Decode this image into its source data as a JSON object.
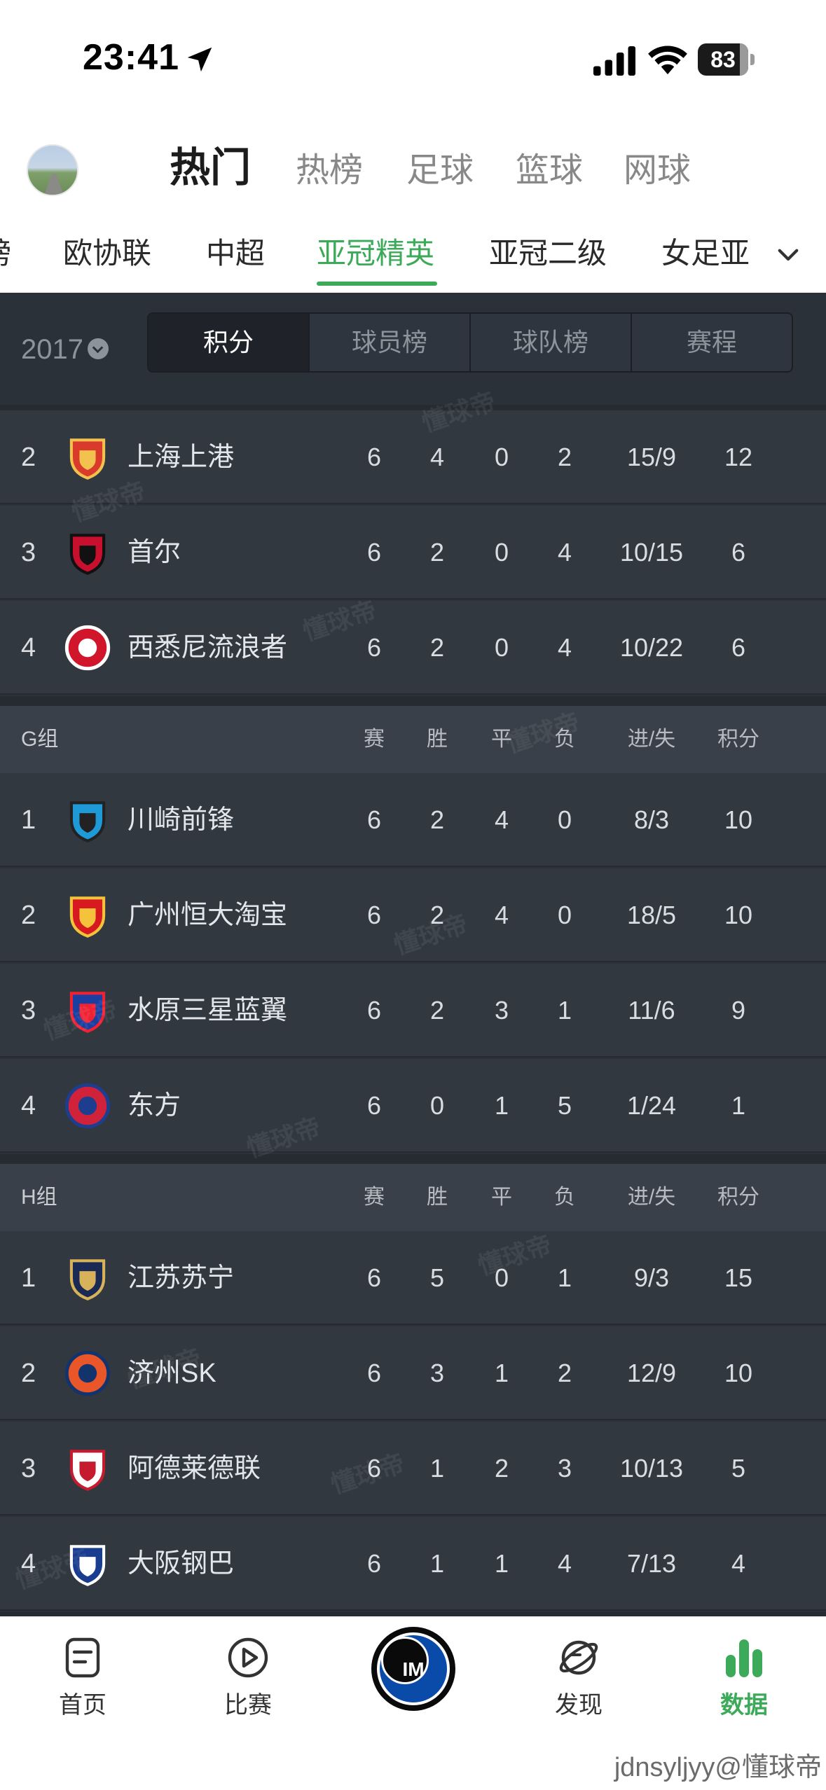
{
  "status_bar": {
    "time": "23:41",
    "battery": "83",
    "battery_level": 0.83
  },
  "header": {
    "main_tabs": [
      {
        "label": "热门",
        "active": true
      },
      {
        "label": "热榜"
      },
      {
        "label": "足球"
      },
      {
        "label": "篮球"
      },
      {
        "label": "网球"
      }
    ],
    "sub_tabs": [
      {
        "label": "榜"
      },
      {
        "label": "欧协联"
      },
      {
        "label": "中超"
      },
      {
        "label": "亚冠精英",
        "active": true
      },
      {
        "label": "亚冠二级"
      },
      {
        "label": "女足亚"
      }
    ]
  },
  "controls": {
    "year": "2017",
    "segments": [
      {
        "label": "积分",
        "active": true
      },
      {
        "label": "球员榜"
      },
      {
        "label": "球队榜"
      },
      {
        "label": "赛程"
      }
    ]
  },
  "columns": [
    "赛",
    "胜",
    "平",
    "负",
    "进/失",
    "积分"
  ],
  "partial_group": {
    "rows": [
      {
        "rank": "2",
        "team": "上海上港",
        "logo": "shanghai-sipg-crest",
        "p": "6",
        "w": "4",
        "d": "0",
        "l": "2",
        "gd": "15/9",
        "pts": "12"
      },
      {
        "rank": "3",
        "team": "首尔",
        "logo": "fc-seoul-crest",
        "p": "6",
        "w": "2",
        "d": "0",
        "l": "4",
        "gd": "10/15",
        "pts": "6"
      },
      {
        "rank": "4",
        "team": "西悉尼流浪者",
        "logo": "western-sydney-crest",
        "p": "6",
        "w": "2",
        "d": "0",
        "l": "4",
        "gd": "10/22",
        "pts": "6"
      }
    ]
  },
  "groups": [
    {
      "name": "G组",
      "rows": [
        {
          "rank": "1",
          "team": "川崎前锋",
          "logo": "kawasaki-frontale-crest",
          "p": "6",
          "w": "2",
          "d": "4",
          "l": "0",
          "gd": "8/3",
          "pts": "10"
        },
        {
          "rank": "2",
          "team": "广州恒大淘宝",
          "logo": "guangzhou-evergrande-crest",
          "p": "6",
          "w": "2",
          "d": "4",
          "l": "0",
          "gd": "18/5",
          "pts": "10"
        },
        {
          "rank": "3",
          "team": "水原三星蓝翼",
          "logo": "suwon-samsung-crest",
          "p": "6",
          "w": "2",
          "d": "3",
          "l": "1",
          "gd": "11/6",
          "pts": "9"
        },
        {
          "rank": "4",
          "team": "东方",
          "logo": "eastern-crest",
          "p": "6",
          "w": "0",
          "d": "1",
          "l": "5",
          "gd": "1/24",
          "pts": "1"
        }
      ]
    },
    {
      "name": "H组",
      "rows": [
        {
          "rank": "1",
          "team": "江苏苏宁",
          "logo": "jiangsu-suning-crest",
          "p": "6",
          "w": "5",
          "d": "0",
          "l": "1",
          "gd": "9/3",
          "pts": "15"
        },
        {
          "rank": "2",
          "team": "济州SK",
          "logo": "jeju-sk-crest",
          "p": "6",
          "w": "3",
          "d": "1",
          "l": "2",
          "gd": "12/9",
          "pts": "10"
        },
        {
          "rank": "3",
          "team": "阿德莱德联",
          "logo": "adelaide-united-crest",
          "p": "6",
          "w": "1",
          "d": "2",
          "l": "3",
          "gd": "10/13",
          "pts": "5"
        },
        {
          "rank": "4",
          "team": "大阪钢巴",
          "logo": "gamba-osaka-crest",
          "p": "6",
          "w": "1",
          "d": "1",
          "l": "4",
          "gd": "7/13",
          "pts": "4"
        }
      ]
    }
  ],
  "watermark": "懂球帝",
  "bottom_nav": [
    {
      "label": "首页",
      "icon": "home-doc-icon"
    },
    {
      "label": "比赛",
      "icon": "play-icon"
    },
    {
      "label": "",
      "icon": "inter-badge-icon"
    },
    {
      "label": "发现",
      "icon": "discover-icon"
    },
    {
      "label": "数据",
      "icon": "data-bars-icon",
      "active": true
    }
  ],
  "footer_tag": "jdnsyljyy@懂球帝",
  "colors": {
    "accent": "#3daa5a",
    "panel": "#2c323b",
    "row": "#323840",
    "group_header": "#3a4049"
  }
}
